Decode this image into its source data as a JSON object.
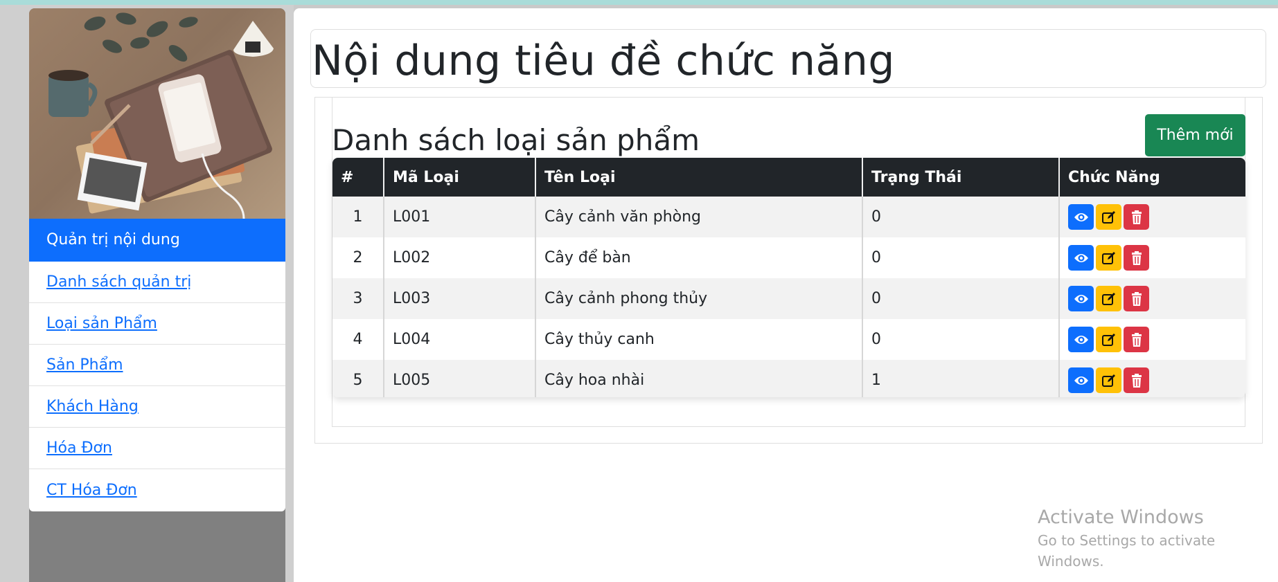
{
  "sidebar": {
    "header": "Quản trị nội dung",
    "items": [
      {
        "label": "Danh sách quản trị"
      },
      {
        "label": "Loại sản Phẩm"
      },
      {
        "label": "Sản Phẩm"
      },
      {
        "label": "Khách Hàng"
      },
      {
        "label": "Hóa Đơn"
      },
      {
        "label": "CT Hóa Đơn"
      }
    ]
  },
  "page": {
    "title": "Nội dung tiêu đề chức năng"
  },
  "section": {
    "title": "Danh sách loại sản phẩm",
    "add_button": "Thêm mới"
  },
  "table": {
    "headers": [
      "#",
      "Mã Loại",
      "Tên Loại",
      "Trạng Thái",
      "Chức Năng"
    ],
    "rows": [
      {
        "num": "1",
        "code": "L001",
        "name": "Cây cảnh văn phòng",
        "status": "0"
      },
      {
        "num": "2",
        "code": "L002",
        "name": "Cây để bàn",
        "status": "0"
      },
      {
        "num": "3",
        "code": "L003",
        "name": "Cây cảnh phong thủy",
        "status": "0"
      },
      {
        "num": "4",
        "code": "L004",
        "name": "Cây thủy canh",
        "status": "0"
      },
      {
        "num": "5",
        "code": "L005",
        "name": "Cây hoa nhài",
        "status": "1"
      }
    ]
  },
  "watermark": {
    "line1": "Activate Windows",
    "line2": "Go to Settings to activate Windows."
  },
  "colors": {
    "primary": "#0d6efd",
    "success": "#198754",
    "warning": "#ffc107",
    "danger": "#dc3545",
    "table_header": "#212529"
  },
  "icons": {
    "view": "eye-icon",
    "edit": "pencil-square-icon",
    "delete": "trash-icon"
  }
}
